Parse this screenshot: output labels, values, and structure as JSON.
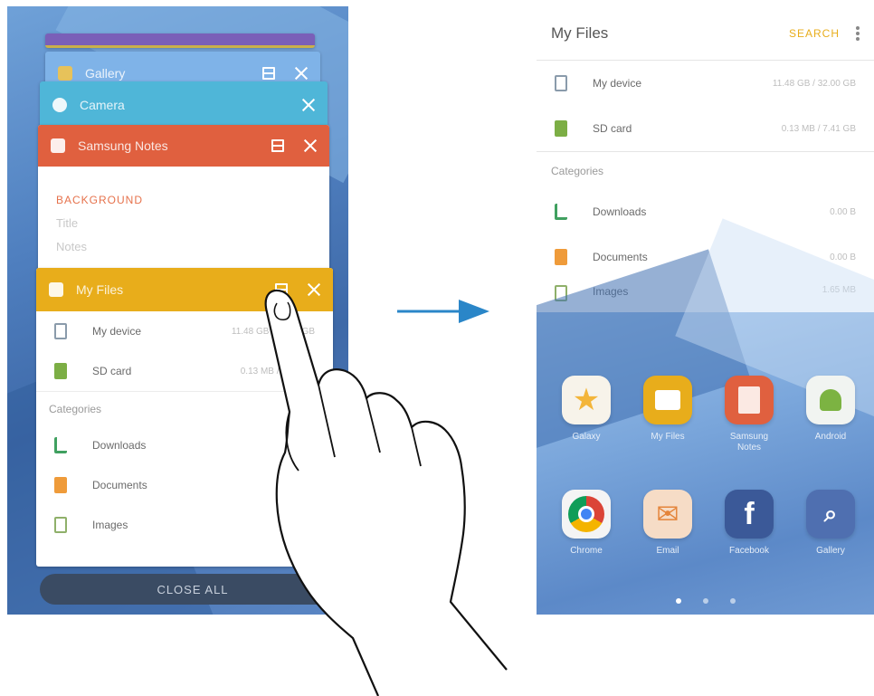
{
  "left": {
    "cards": {
      "gallery": {
        "title": "Gallery",
        "color": "#7fb3e8"
      },
      "camera": {
        "title": "Camera",
        "color": "#4fb6d8"
      },
      "notes": {
        "title": "Samsung Notes",
        "color": "#e0603f",
        "body": [
          "BACKGROUND",
          "Title",
          "Notes"
        ]
      },
      "files": {
        "title": "My Files",
        "color": "#e8ad1b",
        "storage": [
          {
            "label": "My device",
            "meta": "11.48 GB / 32.00 GB",
            "icon": "device-icon"
          },
          {
            "label": "SD card",
            "meta": "0.13 MB / 7.41 GB",
            "icon": "sd-card-icon"
          }
        ],
        "section": "Categories",
        "categories": [
          {
            "label": "Downloads",
            "icon": "downloads-icon"
          },
          {
            "label": "Documents",
            "icon": "documents-icon"
          },
          {
            "label": "Images",
            "icon": "images-icon"
          }
        ]
      }
    },
    "close_all": "CLOSE ALL"
  },
  "right": {
    "title": "My Files",
    "search": "SEARCH",
    "storage": [
      {
        "label": "My device",
        "meta": "11.48 GB / 32.00 GB"
      },
      {
        "label": "SD card",
        "meta": "0.13 MB / 7.41 GB"
      }
    ],
    "section": "Categories",
    "categories": [
      {
        "label": "Downloads",
        "meta": "0.00 B"
      },
      {
        "label": "Documents",
        "meta": "0.00 B"
      },
      {
        "label": "Images",
        "meta": "1.65 MB"
      }
    ],
    "apps": [
      {
        "label": "Galaxy",
        "color": "#f3c34a",
        "glyph": "★"
      },
      {
        "label": "My Files",
        "color": "#e8ad1b",
        "glyph": "▬"
      },
      {
        "label": "Samsung Notes",
        "color": "#e0603f",
        "glyph": "≡"
      },
      {
        "label": "Android",
        "color": "#f1f4f1",
        "glyph": "◉"
      },
      {
        "label": "Chrome",
        "color": "#f4f4f4",
        "glyph": "◎"
      },
      {
        "label": "Email",
        "color": "#f6dcc6",
        "glyph": "✉"
      },
      {
        "label": "Facebook",
        "color": "#3b5998",
        "glyph": "f"
      },
      {
        "label": "Gallery",
        "color": "#4f6fb0",
        "glyph": "⌕"
      }
    ],
    "page_indicator": {
      "count": 3,
      "active": 1
    }
  }
}
